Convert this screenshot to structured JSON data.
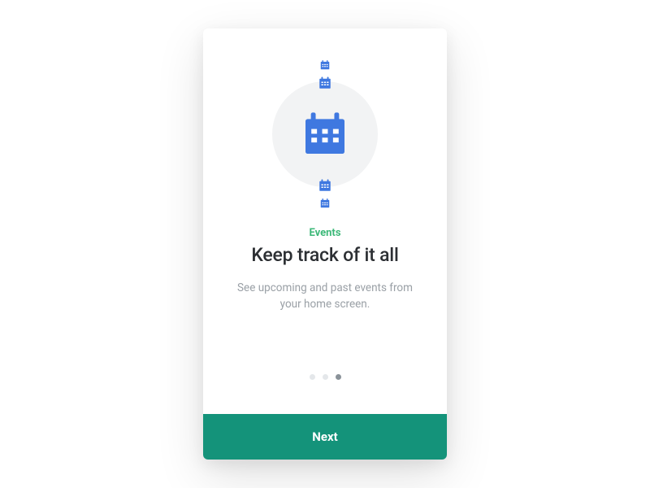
{
  "onboarding": {
    "label": "Events",
    "headline": "Keep track of it all",
    "body": "See upcoming and past events from your home screen.",
    "cta": "Next",
    "page_count": 3,
    "active_page": 3
  },
  "colors": {
    "accent": "#3cb878",
    "cta_bg": "#14937a",
    "icon": "#3f78e0"
  }
}
